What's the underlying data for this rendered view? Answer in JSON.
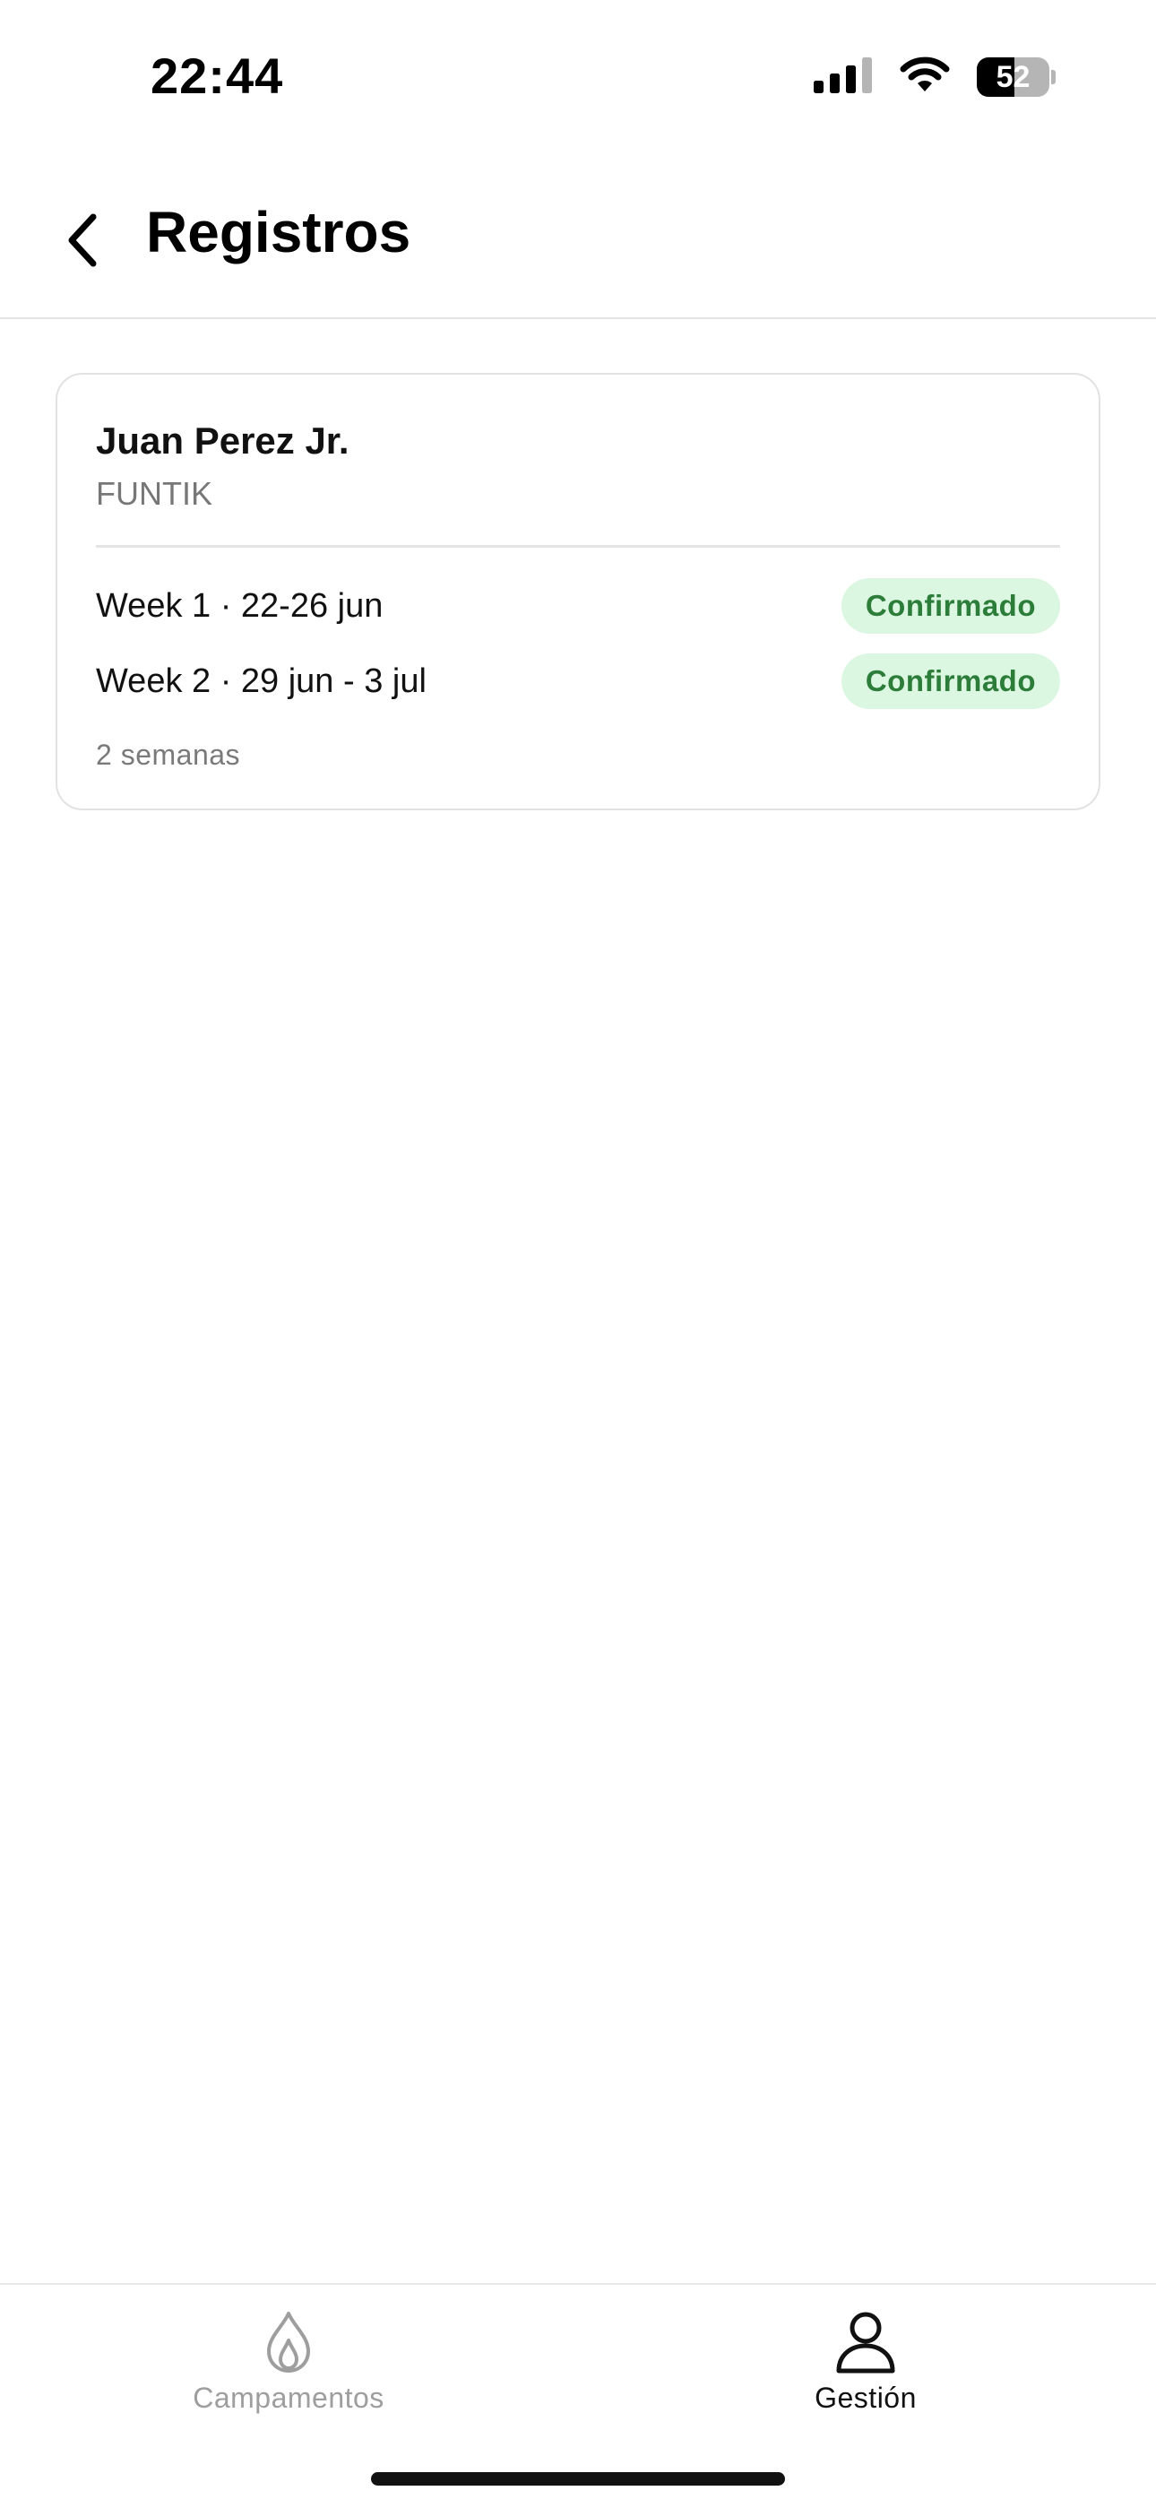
{
  "status_bar": {
    "time": "22:44",
    "battery_level": "52",
    "battery_fraction": 0.52,
    "icons": [
      "cellular-signal-icon",
      "wifi-icon",
      "battery-icon"
    ]
  },
  "header": {
    "title": "Registros",
    "back_icon": "chevron-left-icon"
  },
  "registration": {
    "name": "Juan Perez Jr.",
    "camp": "FUNTIK",
    "weeks": [
      {
        "label": "Week 1 · 22-26 jun",
        "status": "Confirmado"
      },
      {
        "label": "Week 2 · 29 jun - 3 jul",
        "status": "Confirmado"
      }
    ],
    "summary": "2 semanas"
  },
  "tab_bar": {
    "tabs": [
      {
        "label": "Campamentos",
        "icon": "flame-icon",
        "active": false
      },
      {
        "label": "Gestión",
        "icon": "person-icon",
        "active": true
      }
    ]
  },
  "colors": {
    "badge_background": "#dcf7e1",
    "badge_text": "#2d7d3a",
    "inactive_tab": "#9e9e9e",
    "active_tab": "#111111"
  }
}
